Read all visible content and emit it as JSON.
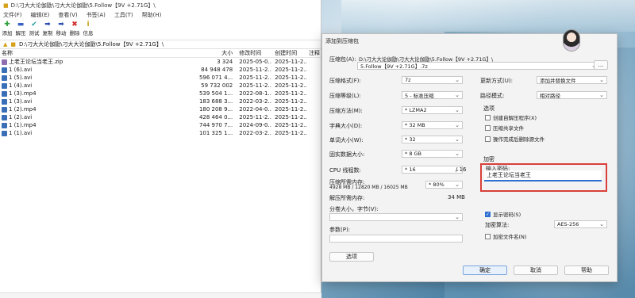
{
  "file_manager": {
    "title": "D:\\刁大大论伽勖\\刁大大论伽勖\\5.Follow【9V +2.71G】\\",
    "menu": [
      "文件(F)",
      "编辑(E)",
      "查看(V)",
      "书签(A)",
      "工具(T)",
      "帮助(H)"
    ],
    "toolbar": [
      {
        "label": "添加",
        "icon": "add-icon",
        "color": "#2e9e3a",
        "glyph": "✚"
      },
      {
        "label": "解压",
        "icon": "extract-icon",
        "color": "#3a5fc4",
        "glyph": "▬"
      },
      {
        "label": "测试",
        "icon": "test-icon",
        "color": "#2aa3a3",
        "glyph": "✔"
      },
      {
        "label": "复制",
        "icon": "copy-icon",
        "color": "#2a4fb0",
        "glyph": "➡"
      },
      {
        "label": "移动",
        "icon": "move-icon",
        "color": "#2a4fb0",
        "glyph": "➡"
      },
      {
        "label": "删除",
        "icon": "delete-icon",
        "color": "#d22a2a",
        "glyph": "✖"
      },
      {
        "label": "信息",
        "icon": "info-icon",
        "color": "#c9a114",
        "glyph": "i"
      }
    ],
    "path": "D:\\刁大大论伽勖\\刁大大论伽勖\\5.Follow【9V +2.71G】\\",
    "columns": {
      "name": "名称",
      "size": "大小",
      "modified": "修改时间",
      "created": "创建时间",
      "comment": "注释"
    },
    "files": [
      {
        "name": "上老王论坛当老王.zip",
        "size": "3 324",
        "modified": "2025-05-0...",
        "created": "2025-11-2...",
        "type": "zip"
      },
      {
        "name": "1 (6).avi",
        "size": "84 948 478",
        "modified": "2025-11-2...",
        "created": "2025-11-2...",
        "type": "video"
      },
      {
        "name": "1 (5).avi",
        "size": "596 071 4...",
        "modified": "2025-11-2...",
        "created": "2025-11-2...",
        "type": "video"
      },
      {
        "name": "1 (4).avi",
        "size": "59 732 002",
        "modified": "2025-11-2...",
        "created": "2025-11-2...",
        "type": "video"
      },
      {
        "name": "1 (3).mp4",
        "size": "539 504 1...",
        "modified": "2022-08-1...",
        "created": "2025-11-2...",
        "type": "video"
      },
      {
        "name": "1 (3).avi",
        "size": "183 688 3...",
        "modified": "2022-03-2...",
        "created": "2025-11-2...",
        "type": "video"
      },
      {
        "name": "1 (2).mp4",
        "size": "180 208 9...",
        "modified": "2022-04-0...",
        "created": "2025-11-2...",
        "type": "video"
      },
      {
        "name": "1 (2).avi",
        "size": "428 464 0...",
        "modified": "2025-11-2...",
        "created": "2025-11-2...",
        "type": "video"
      },
      {
        "name": "1 (1).mp4",
        "size": "744 970 7...",
        "modified": "2024-09-0...",
        "created": "2025-11-2...",
        "type": "video"
      },
      {
        "name": "1 (1).avi",
        "size": "101 325 1...",
        "modified": "2022-03-2...",
        "created": "2025-11-2...",
        "type": "video"
      }
    ]
  },
  "dialog": {
    "title": "添加到压缩包",
    "archive_label": "压缩包(A):",
    "archive_dir": "D:\\刁大大论伽勖\\刁大大论伽勖\\5.Follow【9V +2.71G】\\",
    "archive_name": "5.Follow【9V +2.71G】.7z",
    "browse_label": "...",
    "format_label": "压缩格式(F):",
    "format_value": "7z",
    "level_label": "压缩等级(L):",
    "level_value": "5 - 标准压缩",
    "method_label": "压缩方法(M):",
    "method_value": "* LZMA2",
    "dict_label": "字典大小(D):",
    "dict_value": "* 32 MB",
    "word_label": "单词大小(W):",
    "word_value": "* 32",
    "solid_label": "固实数据大小:",
    "solid_value": "* 8 GB",
    "threads_label": "CPU 线程数:",
    "threads_value": "* 16",
    "threads_total": "/ 16",
    "mem_label": "压缩所需内存:",
    "mem_detail": "4928 MB / 12820 MB / 16025 MB",
    "mem_value": "* 80%",
    "decomp_label": "解压所需内存:",
    "decomp_value": "34 MB",
    "split_label": "分卷大小，字节(V):",
    "split_value": "",
    "params_label": "参数(P):",
    "params_value": "",
    "options_button": "选项",
    "update_label": "更新方式(U):",
    "update_value": "添加并替换文件",
    "pathmode_label": "路径模式:",
    "pathmode_value": "相对路径",
    "options_group": "选项",
    "opt_sfx": "创建自解压程序(X)",
    "opt_shared": "压缩共享文件",
    "opt_delete": "操作完成后删除源文件",
    "encrypt_group": "加密",
    "pw_label": "输入密码:",
    "pw_value": "上老王论坛当老王",
    "show_pw": "显示密码(S)",
    "enc_method_label": "加密算法:",
    "enc_method_value": "AES-256",
    "encrypt_names": "加密文件名(N)",
    "ok": "确定",
    "cancel": "取消",
    "help": "帮助"
  }
}
